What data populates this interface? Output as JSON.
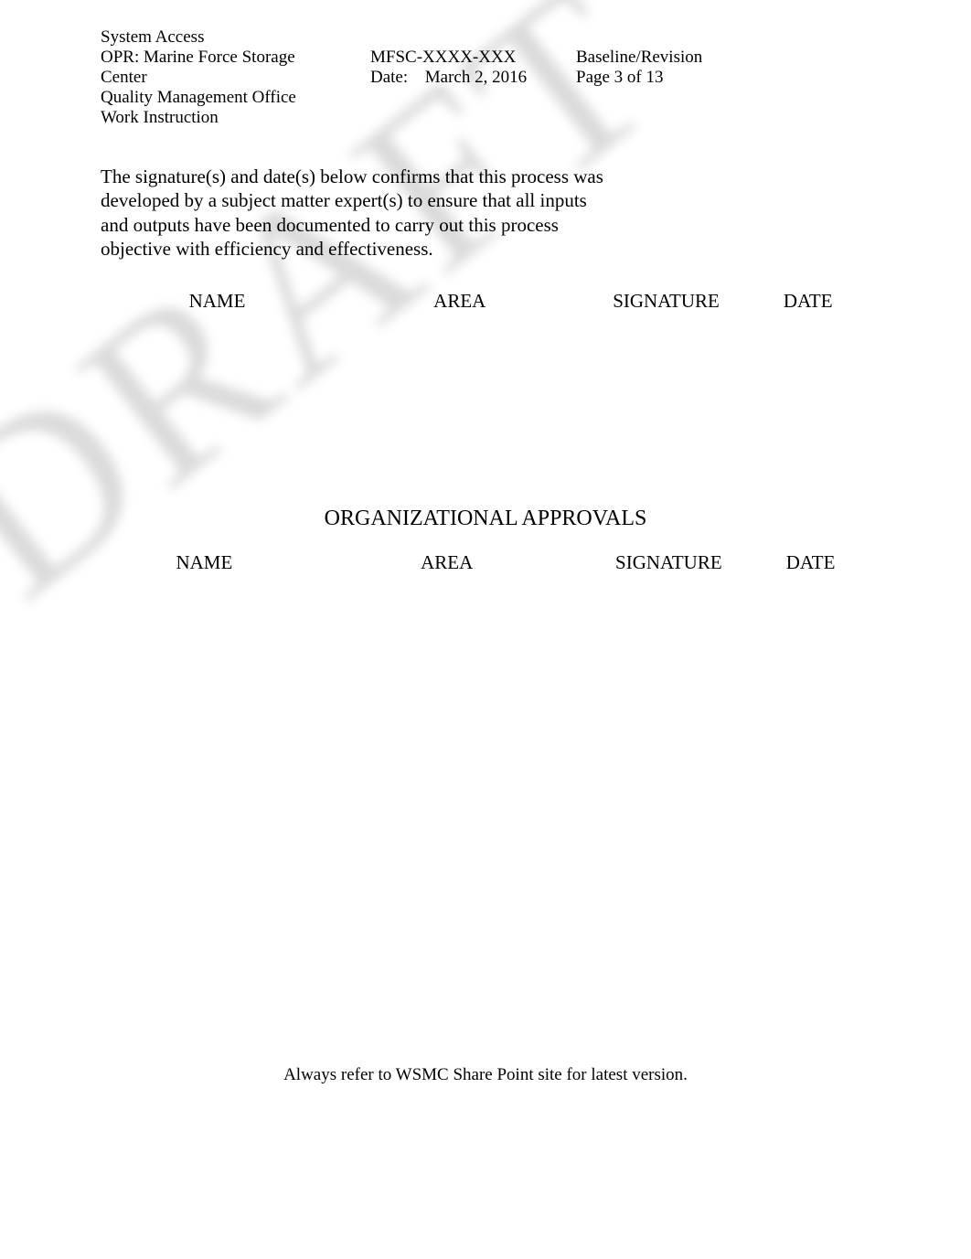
{
  "header": {
    "title": "System Access",
    "opr_line1": "OPR: Marine Force Storage",
    "opr_line2": "Center",
    "opr_line3": "Quality Management Office",
    "opr_line4": "Work Instruction",
    "doc_code": "MFSC-XXXX-XXX",
    "date_label": "Date:",
    "date_value": "March 2, 2016",
    "baseline": "Baseline/Revision",
    "page": "Page 3 of 13"
  },
  "intro": "The signature(s) and date(s) below confirms that this process was developed by a subject matter expert(s) to ensure that all inputs and outputs have been documented to carry out this process objective with efficiency and effectiveness.",
  "sig_table": {
    "columns": {
      "name": "NAME",
      "area": "AREA",
      "signature": "SIGNATURE",
      "date": "DATE"
    },
    "rows": [
      {
        "name": "",
        "area": "",
        "signature": "",
        "date": ""
      },
      {
        "name": "",
        "area": "",
        "signature": "",
        "date": ""
      },
      {
        "name": "",
        "area": "",
        "signature": "",
        "date": ""
      },
      {
        "name": "",
        "area": "",
        "signature": "",
        "date": ""
      },
      {
        "name": "",
        "area": "",
        "signature": "",
        "date": ""
      },
      {
        "name": "",
        "area": "",
        "signature": "",
        "date": ""
      },
      {
        "name": "",
        "area": "",
        "signature": "",
        "date": ""
      },
      {
        "name": "",
        "area": "",
        "signature": "",
        "date": ""
      }
    ]
  },
  "org_section_title": "ORGANIZATIONAL APPROVALS",
  "org_table": {
    "columns": {
      "name": "NAME",
      "area": "AREA",
      "signature": "SIGNATURE",
      "date": "DATE"
    },
    "rows": [
      {
        "name": "",
        "area": "",
        "signature": "",
        "date": ""
      },
      {
        "name": "",
        "area": "",
        "signature": "",
        "date": ""
      }
    ]
  },
  "footer": "Always refer to WSMC Share Point site for latest version.",
  "watermark": "DRAFT"
}
